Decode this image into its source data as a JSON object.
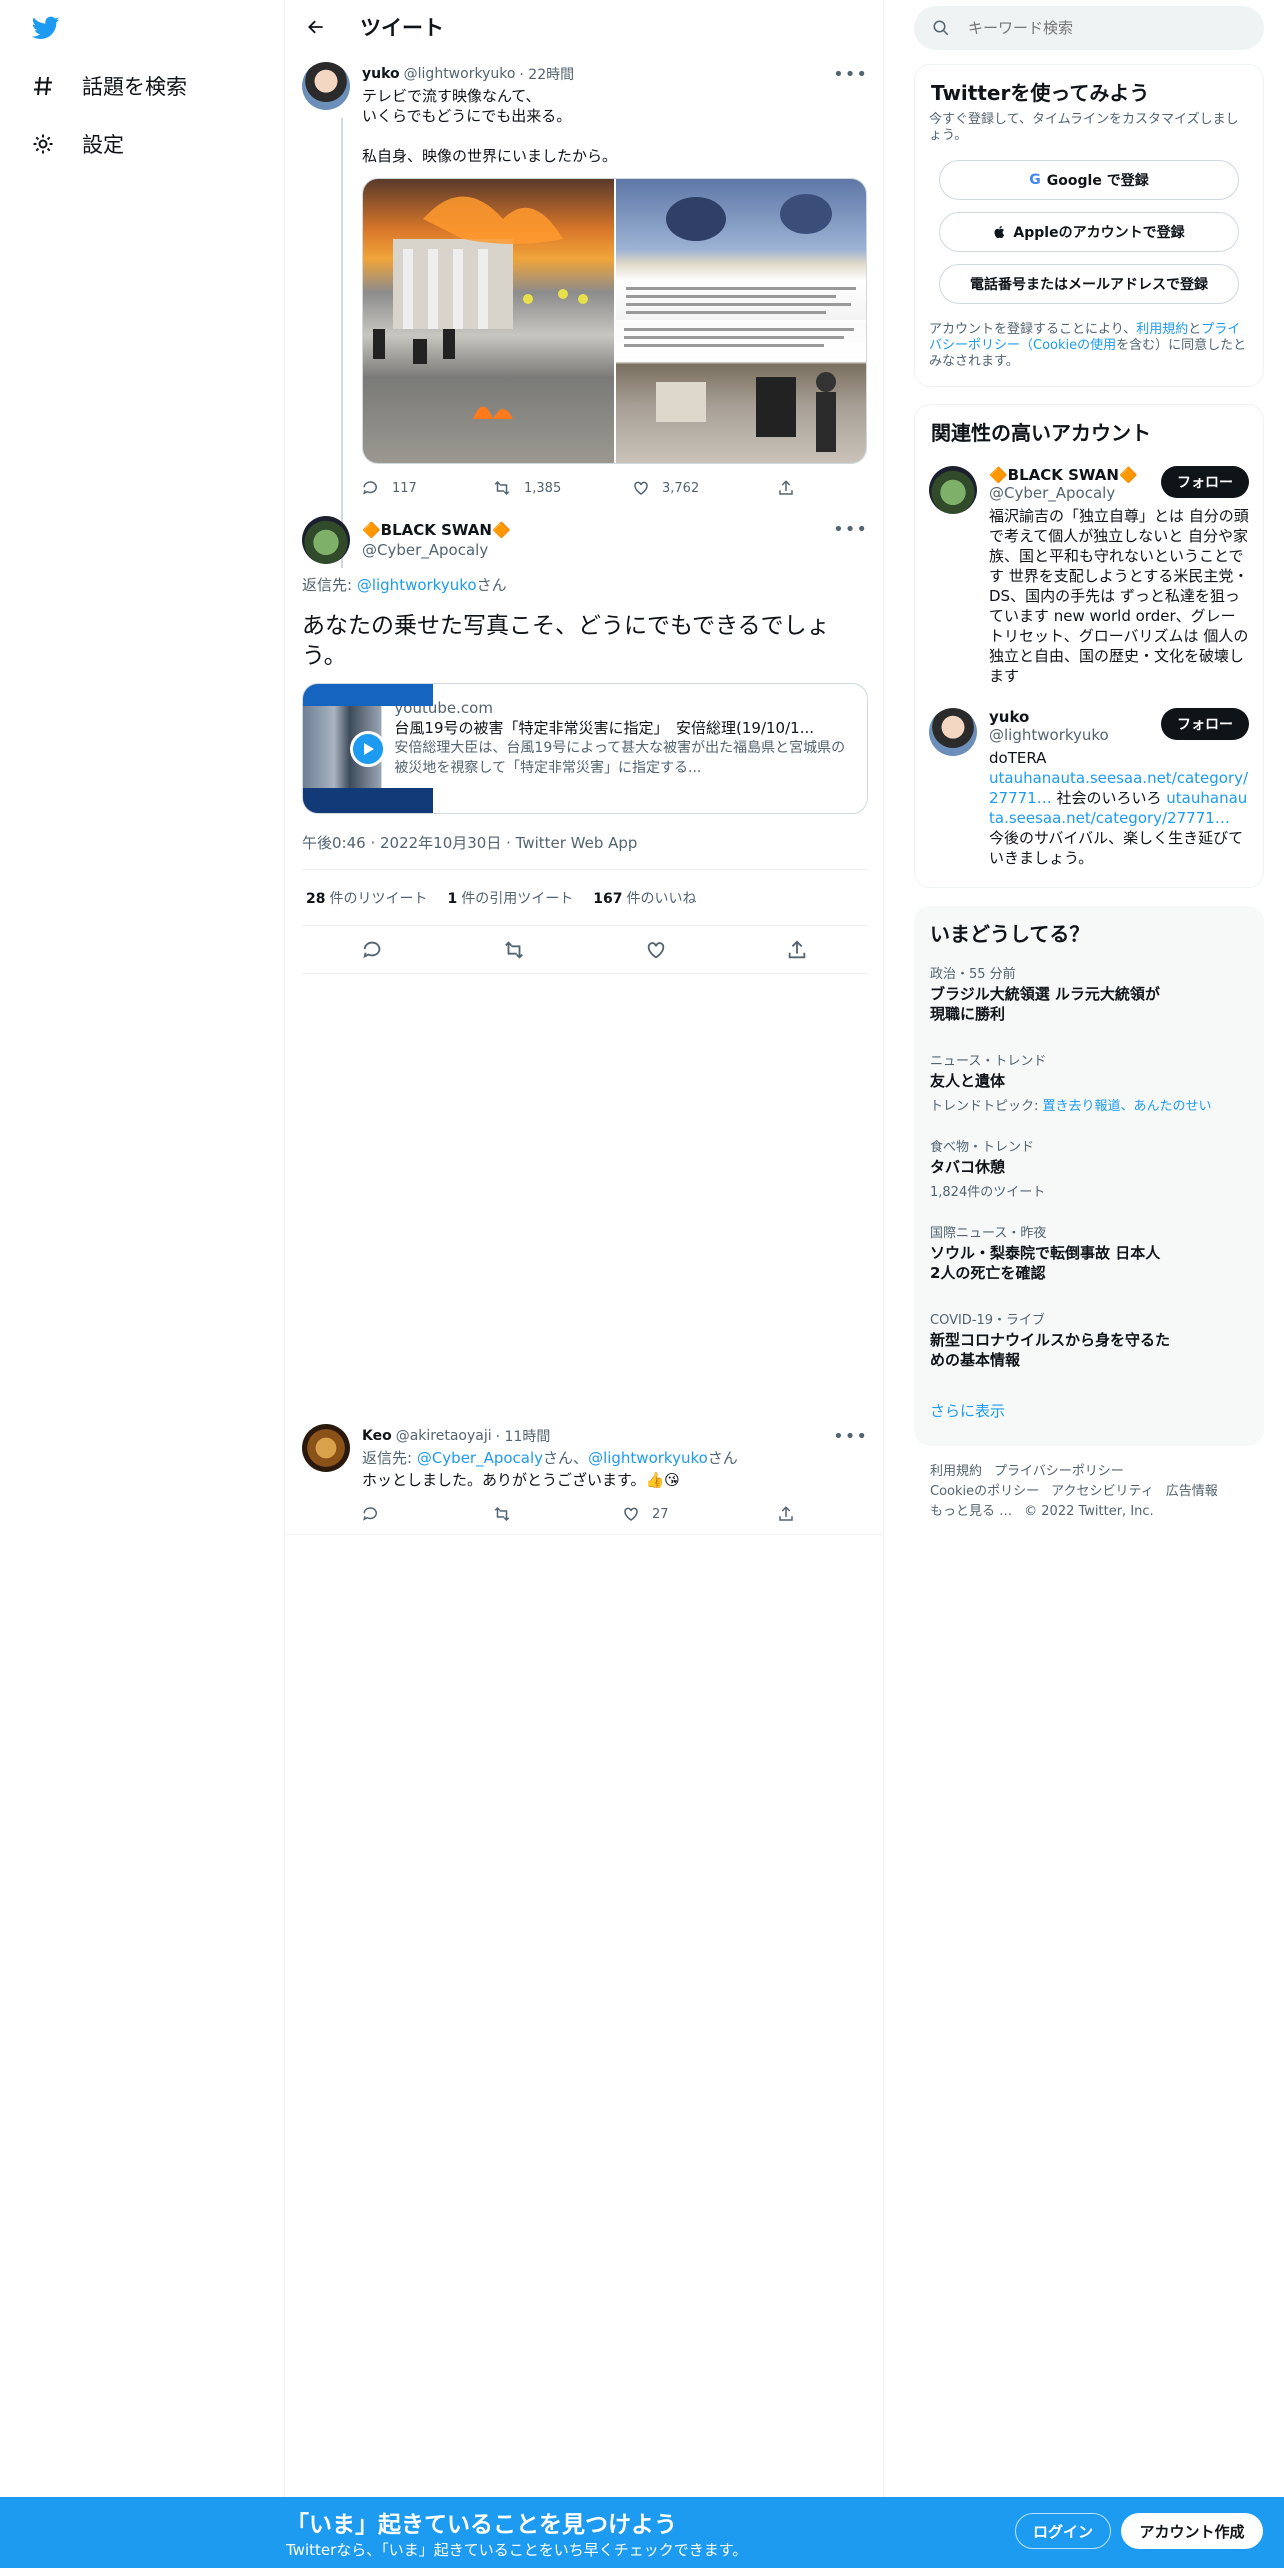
{
  "nav": {
    "explore_label": "話題を検索",
    "settings_label": "設定"
  },
  "header": {
    "title": "ツイート"
  },
  "tweet1": {
    "name": "yuko",
    "handle": "@lightworkyuko",
    "time": "· 22時間",
    "text": "テレビで流す映像なんて、\nいくらでもどうにでも出来る。\n\n私自身、映像の世界にいましたから。",
    "replies": "117",
    "retweets": "1,385",
    "likes": "3,762"
  },
  "tweet2": {
    "name": "🔶BLACK SWAN🔶",
    "handle": "@Cyber_Apocaly",
    "reply_prefix": "返信先: ",
    "reply_to": "@lightworkyuko",
    "reply_suffix": "さん",
    "text": "あなたの乗せた写真こそ、どうにでもできるでしょう。",
    "card": {
      "domain": "youtube.com",
      "title": "台風19号の被害「特定非常災害に指定」　安倍総理(19/10/1...",
      "desc": "安倍総理大臣は、台風19号によって甚大な被害が出た福島県と宮城県の被災地を視察して「特定非常災害」に指定する..."
    },
    "timestamp": "午後0:46 · 2022年10月30日 · Twitter Web App",
    "retweet_count": "28",
    "retweet_label": "件のリツイート",
    "quote_count": "1",
    "quote_label": "件の引用ツイート",
    "like_count": "167",
    "like_label": "件のいいね"
  },
  "tweet3": {
    "name": "Keo",
    "handle": "@akiretaoyaji",
    "time": "· 11時間",
    "reply_prefix": "返信先: ",
    "reply_to_1": "@Cyber_Apocaly",
    "reply_mid": "さん、",
    "reply_to_2": "@lightworkyuko",
    "reply_suffix": "さん",
    "text": "ホッとしました。ありがとうございます。👍😘",
    "likes": "27"
  },
  "search": {
    "placeholder": "キーワード検索"
  },
  "signup_panel": {
    "title": "Twitterを使ってみよう",
    "subtitle": "今すぐ登録して、タイムラインをカスタマイズしましょう。",
    "google": "Google で登録",
    "apple": "Appleのアカウントで登録",
    "phone": "電話番号またはメールアドレスで登録",
    "legal_1": "アカウントを登録することにより、",
    "legal_terms": "利用規約",
    "legal_2": "と",
    "legal_privacy": "プライバシーポリシー",
    "legal_cookie": "（Cookieの使用",
    "legal_3": "を含む）に同意したとみなされます。"
  },
  "related_panel": {
    "title": "関連性の高いアカウント",
    "follow_label": "フォロー",
    "accounts": [
      {
        "name": "🔶BLACK SWAN🔶",
        "handle": "@Cyber_Apocaly",
        "bio": "福沢諭吉の「独立自尊」とは 自分の頭で考えて個人が独立しないと 自分や家族、国と平和も守れないということです 世界を支配しようとする米民主党・DS、国内の手先は ずっと私達を狙っています new world order、グレートリセット、グローバリズムは 個人の独立と自由、国の歴史・文化を破壊します"
      },
      {
        "name": "yuko",
        "handle": "@lightworkyuko",
        "bio_1": "doTERA",
        "bio_link_1": "utauhanauta.seesaa.net/category/27771…",
        "bio_2": " 社会のいろいろ",
        "bio_link_2": "utauhanauta.seesaa.net/category/27771…",
        "bio_3": " 今後のサバイバル、楽しく生き延びていきましょう。"
      }
    ]
  },
  "trends_panel": {
    "title": "いまどうしてる？",
    "items": [
      {
        "context": "政治・55 分前",
        "name": "ブラジル大統領選 ルラ元大統領が現職に勝利"
      },
      {
        "context": "ニュース・トレンド",
        "name": "友人と遺体",
        "sub_prefix": "トレンドトピック: ",
        "sub_links": "置き去り報道、あんたのせい"
      },
      {
        "context": "食べ物・トレンド",
        "name": "タバコ休憩",
        "sub": "1,824件のツイート"
      },
      {
        "context": "国際ニュース・昨夜",
        "name": "ソウル・梨泰院で転倒事故 日本人2人の死亡を確認"
      },
      {
        "context": "COVID-19・ライブ",
        "name": "新型コロナウイルスから身を守るための基本情報"
      }
    ],
    "show_more": "さらに表示"
  },
  "footer": {
    "terms": "利用規約",
    "privacy": "プライバシーポリシー",
    "cookie": "Cookieのポリシー",
    "accessibility": "アクセシビリティ",
    "ads": "広告情報",
    "more": "もっと見る …",
    "copyright": "© 2022 Twitter, Inc."
  },
  "bottom_bar": {
    "headline": "「いま」起きていることを見つけよう",
    "sub": "Twitterなら、「いま」起きていることをいち早くチェックできます。",
    "login": "ログイン",
    "signup": "アカウント作成"
  },
  "colors": {
    "accent": "#1d9bf0",
    "text": "#0f1419",
    "muted": "#536471",
    "border": "#eff3f4"
  },
  "icons": [
    "twitter-logo-icon",
    "hashtag-icon",
    "gear-icon",
    "back-arrow-icon",
    "more-icon",
    "reply-icon",
    "retweet-icon",
    "like-icon",
    "share-icon",
    "search-icon",
    "google-icon",
    "apple-icon",
    "play-icon"
  ]
}
